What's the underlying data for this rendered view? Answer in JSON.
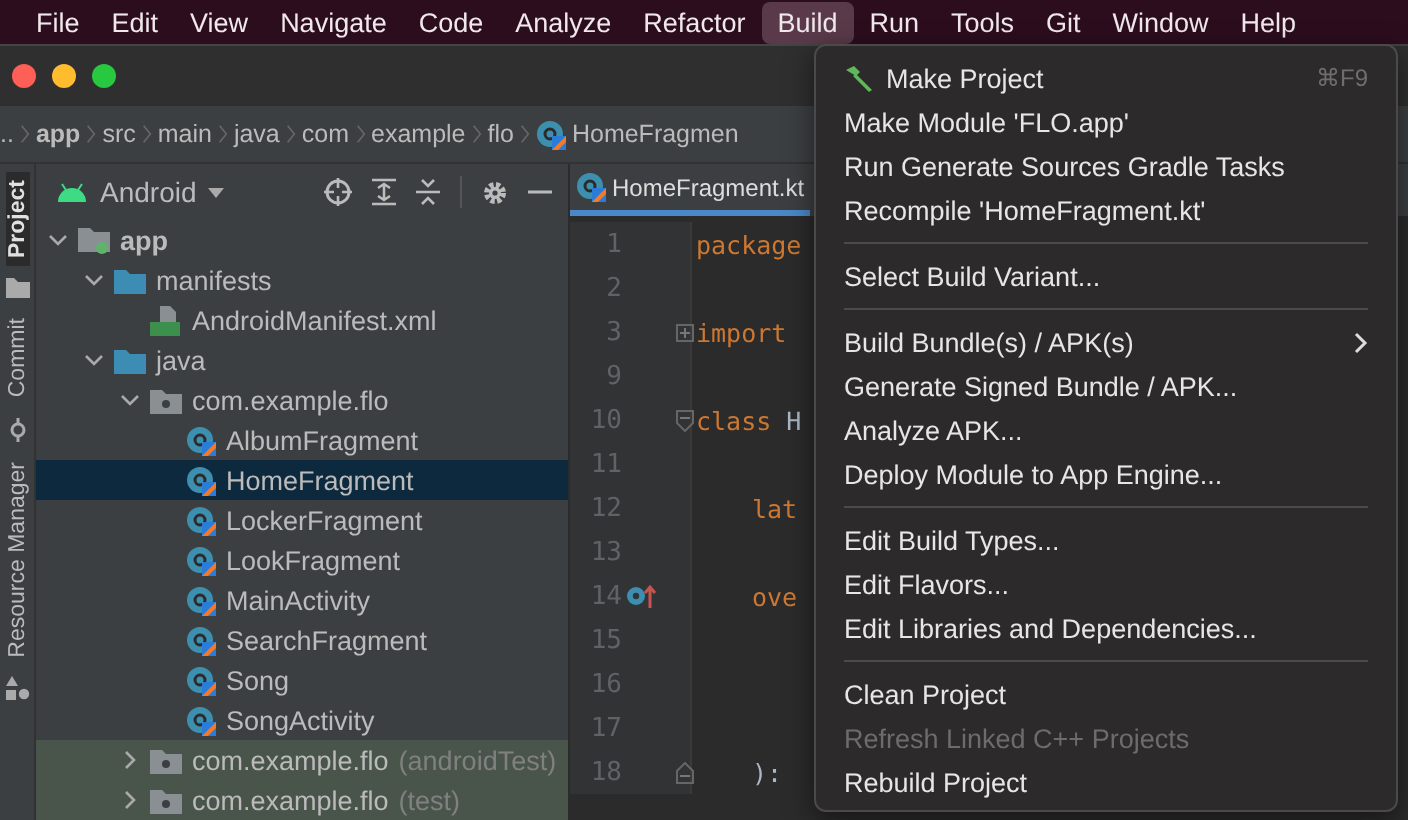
{
  "menu_bar": [
    {
      "label": "File",
      "selected": false
    },
    {
      "label": "Edit",
      "selected": false
    },
    {
      "label": "View",
      "selected": false
    },
    {
      "label": "Navigate",
      "selected": false
    },
    {
      "label": "Code",
      "selected": false
    },
    {
      "label": "Analyze",
      "selected": false
    },
    {
      "label": "Refactor",
      "selected": false
    },
    {
      "label": "Build",
      "selected": true
    },
    {
      "label": "Run",
      "selected": false
    },
    {
      "label": "Tools",
      "selected": false
    },
    {
      "label": "Git",
      "selected": false
    },
    {
      "label": "Window",
      "selected": false
    },
    {
      "label": "Help",
      "selected": false
    }
  ],
  "breadcrumbs": [
    {
      "label": "..",
      "kind": "plain"
    },
    {
      "label": "app",
      "kind": "module"
    },
    {
      "label": "src",
      "kind": "plain"
    },
    {
      "label": "main",
      "kind": "plain"
    },
    {
      "label": "java",
      "kind": "plain"
    },
    {
      "label": "com",
      "kind": "plain"
    },
    {
      "label": "example",
      "kind": "plain"
    },
    {
      "label": "flo",
      "kind": "plain"
    },
    {
      "label": "HomeFragmen",
      "kind": "kotlin"
    }
  ],
  "side_tabs": [
    {
      "label": "Project",
      "selected": true
    },
    {
      "label": "Commit",
      "selected": false
    },
    {
      "label": "Resource Manager",
      "selected": false
    }
  ],
  "project_panel": {
    "view": "Android",
    "tree": [
      {
        "label": "app",
        "kind": "module",
        "expanded": true,
        "selected": false,
        "children": [
          {
            "label": "manifests",
            "kind": "folder",
            "expanded": true,
            "selected": false,
            "children": [
              {
                "label": "AndroidManifest.xml",
                "kind": "manifest",
                "selected": false
              }
            ]
          },
          {
            "label": "java",
            "kind": "folder",
            "expanded": true,
            "selected": false,
            "children": [
              {
                "label": "com.example.flo",
                "kind": "package",
                "expanded": true,
                "selected": false,
                "children": [
                  {
                    "label": "AlbumFragment",
                    "kind": "kotlin",
                    "selected": false
                  },
                  {
                    "label": "HomeFragment",
                    "kind": "kotlin",
                    "selected": true
                  },
                  {
                    "label": "LockerFragment",
                    "kind": "kotlin",
                    "selected": false
                  },
                  {
                    "label": "LookFragment",
                    "kind": "kotlin",
                    "selected": false
                  },
                  {
                    "label": "MainActivity",
                    "kind": "kotlin",
                    "selected": false
                  },
                  {
                    "label": "SearchFragment",
                    "kind": "kotlin",
                    "selected": false
                  },
                  {
                    "label": "Song",
                    "kind": "kotlin",
                    "selected": false
                  },
                  {
                    "label": "SongActivity",
                    "kind": "kotlin",
                    "selected": false
                  }
                ]
              },
              {
                "label": "com.example.flo",
                "qualifier": "(androidTest)",
                "kind": "test-package",
                "expanded": false,
                "selected": false
              },
              {
                "label": "com.example.flo",
                "qualifier": "(test)",
                "kind": "test-package",
                "expanded": false,
                "selected": false
              }
            ]
          }
        ]
      }
    ]
  },
  "editor": {
    "tab": {
      "label": "HomeFragment.kt",
      "selected": true
    },
    "lines": [
      {
        "number": "1",
        "code": "package",
        "indent": false,
        "kind": "plain"
      },
      {
        "number": "2",
        "kind": "plain"
      },
      {
        "number": "3",
        "code": "import",
        "indent": false,
        "kind": "fold-start"
      },
      {
        "number": "9",
        "kind": "plain"
      },
      {
        "number": "10",
        "code": "class",
        "rest": "H",
        "indent": false,
        "kind": "fold-block"
      },
      {
        "number": "11",
        "kind": "plain"
      },
      {
        "number": "12",
        "code": "lat",
        "indent": true,
        "kind": "plain"
      },
      {
        "number": "13",
        "kind": "plain"
      },
      {
        "number": "14",
        "code": "ove",
        "indent": true,
        "kind": "override"
      },
      {
        "number": "15",
        "kind": "plain"
      },
      {
        "number": "16",
        "kind": "plain"
      },
      {
        "number": "17",
        "kind": "plain"
      },
      {
        "number": "18",
        "rest": "):",
        "indent": true,
        "kind": "fold-end"
      }
    ]
  },
  "build_menu": [
    {
      "kind": "item",
      "label": "Make Project",
      "shortcut": "⌘F9",
      "disabled": false
    },
    {
      "kind": "item",
      "label": "Make Module 'FLO.app'",
      "disabled": false
    },
    {
      "kind": "item",
      "label": "Run Generate Sources Gradle Tasks",
      "disabled": false
    },
    {
      "kind": "item",
      "label": "Recompile 'HomeFragment.kt'",
      "disabled": false
    },
    {
      "kind": "separator"
    },
    {
      "kind": "item",
      "label": "Select Build Variant...",
      "disabled": false
    },
    {
      "kind": "separator"
    },
    {
      "kind": "submenu",
      "label": "Build Bundle(s) / APK(s)",
      "disabled": false
    },
    {
      "kind": "item",
      "label": "Generate Signed Bundle / APK...",
      "disabled": false
    },
    {
      "kind": "item",
      "label": "Analyze APK...",
      "disabled": false
    },
    {
      "kind": "item",
      "label": "Deploy Module to App Engine...",
      "disabled": false
    },
    {
      "kind": "separator"
    },
    {
      "kind": "item",
      "label": "Edit Build Types...",
      "disabled": false
    },
    {
      "kind": "item",
      "label": "Edit Flavors...",
      "disabled": false
    },
    {
      "kind": "item",
      "label": "Edit Libraries and Dependencies...",
      "disabled": false
    },
    {
      "kind": "separator"
    },
    {
      "kind": "item",
      "label": "Clean Project",
      "disabled": false
    },
    {
      "kind": "item",
      "label": "Refresh Linked C++ Projects",
      "disabled": true
    },
    {
      "kind": "item",
      "label": "Rebuild Project",
      "disabled": false
    }
  ]
}
